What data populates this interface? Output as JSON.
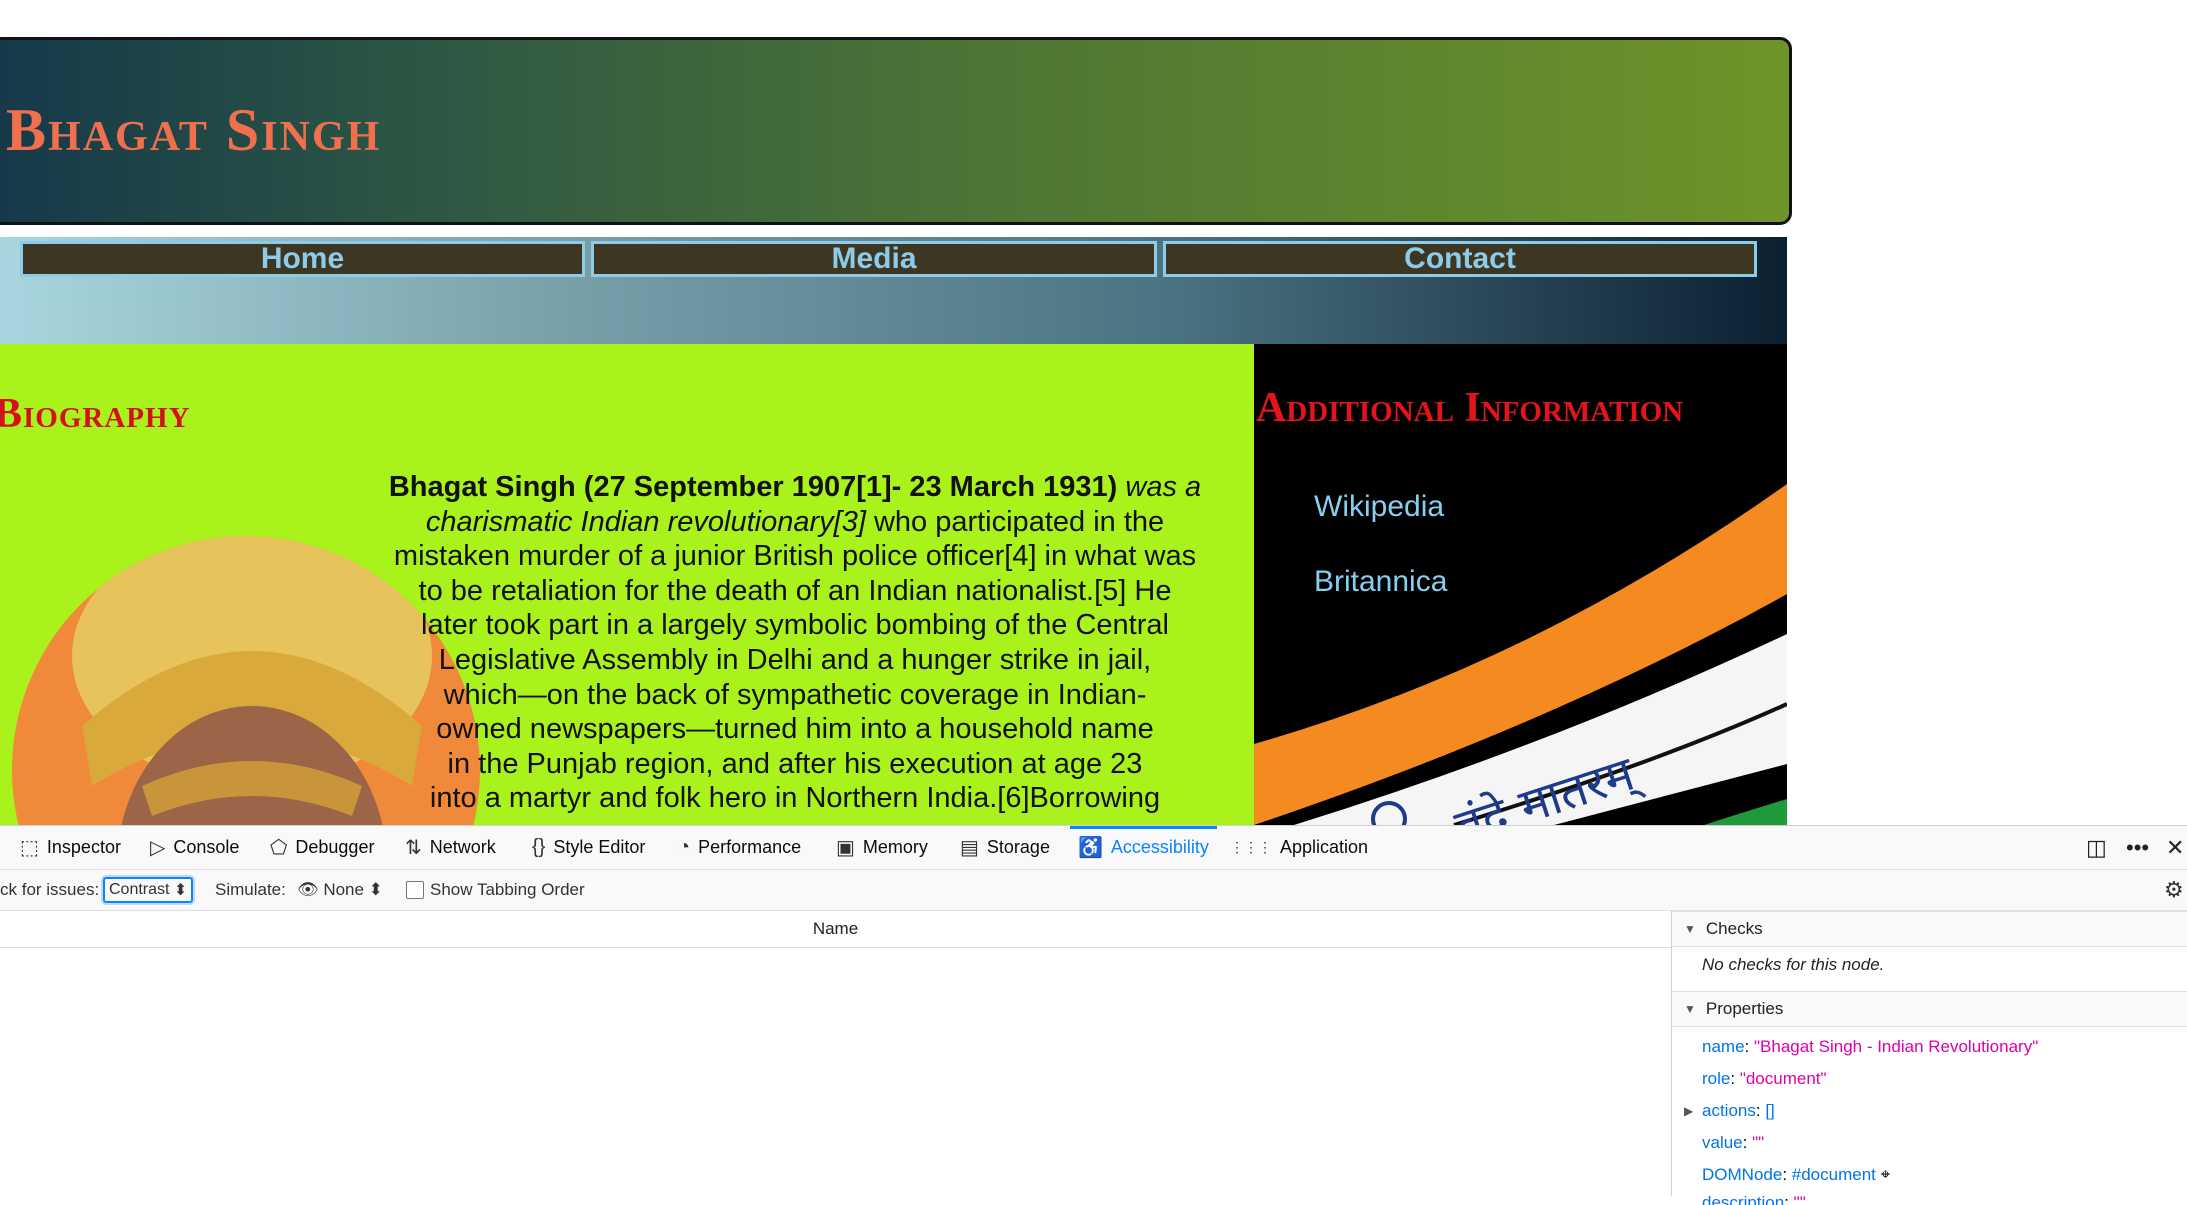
{
  "page": {
    "site_title": "Bhagat Singh",
    "nav": [
      "Home",
      "Media",
      "Contact"
    ],
    "biography_title": "Biography",
    "bio_lines": [
      {
        "parts": [
          {
            "t": "Bhagat Singh (27 September 1907[1]- 23 March 1931)",
            "s": "b"
          },
          {
            "t": " was a",
            "s": "i"
          }
        ]
      },
      {
        "parts": [
          {
            "t": "charismatic Indian revolutionary[3]",
            "s": "i"
          },
          {
            "t": " who participated in the",
            "s": "n"
          }
        ]
      },
      {
        "parts": [
          {
            "t": "mistaken murder of a junior British police officer[4] in what was",
            "s": "n"
          }
        ]
      },
      {
        "parts": [
          {
            "t": "to be retaliation for the death of an Indian nationalist.[5] He",
            "s": "n"
          }
        ]
      },
      {
        "parts": [
          {
            "t": "later took part in a largely symbolic bombing of the Central",
            "s": "n"
          }
        ]
      },
      {
        "parts": [
          {
            "t": "Legislative Assembly in Delhi and a hunger strike in jail,",
            "s": "n"
          }
        ]
      },
      {
        "parts": [
          {
            "t": "which—on the back of sympathetic coverage in Indian-",
            "s": "n"
          }
        ]
      },
      {
        "parts": [
          {
            "t": "owned newspapers—turned him into a household name",
            "s": "n"
          }
        ]
      },
      {
        "parts": [
          {
            "t": "in the Punjab region, and after his execution at age 23",
            "s": "n"
          }
        ]
      },
      {
        "parts": [
          {
            "t": "into a martyr and folk hero in Northern India.[6]Borrowing",
            "s": "n"
          }
        ]
      }
    ],
    "additional_title": "Additional Information",
    "links": [
      "Wikipedia",
      "Britannica"
    ],
    "flag_text": "वंदे मातरम्"
  },
  "devtools": {
    "tabs": [
      {
        "label": "Inspector",
        "icon": "inspector-icon",
        "glyph": "⬚"
      },
      {
        "label": "Console",
        "icon": "console-icon",
        "glyph": "▷"
      },
      {
        "label": "Debugger",
        "icon": "debugger-icon",
        "glyph": "⬠"
      },
      {
        "label": "Network",
        "icon": "network-icon",
        "glyph": "⇅"
      },
      {
        "label": "Style Editor",
        "icon": "style-editor-icon",
        "glyph": "{}"
      },
      {
        "label": "Performance",
        "icon": "performance-icon",
        "glyph": "◔"
      },
      {
        "label": "Memory",
        "icon": "memory-icon",
        "glyph": "▣"
      },
      {
        "label": "Storage",
        "icon": "storage-icon",
        "glyph": "▤"
      },
      {
        "label": "Accessibility",
        "icon": "accessibility-icon",
        "glyph": "♿"
      },
      {
        "label": "Application",
        "icon": "application-icon",
        "glyph": "⋮⋮⋮"
      }
    ],
    "active_tab": "Accessibility",
    "check_label": "ck for issues:",
    "check_value": "Contrast",
    "simulate_label": "Simulate:",
    "simulate_value": "None",
    "tabbing_label": "Show Tabbing Order",
    "tree_column": "Name",
    "checks_title": "Checks",
    "checks_empty": "No checks for this node.",
    "properties_title": "Properties",
    "properties": {
      "name_key": "name",
      "name_val": "\"Bhagat Singh - Indian Revolutionary\"",
      "role_key": "role",
      "role_val": "\"document\"",
      "actions_key": "actions",
      "actions_val": "[]",
      "value_key": "value",
      "value_val": "\"\"",
      "domnode_key": "DOMNode",
      "domnode_val": "#document",
      "description_key": "description",
      "description_val": "\"\""
    }
  },
  "colors": {
    "title": "#f0704e",
    "section_title": "#d4111a",
    "nav_text": "#8ecbe9",
    "bio_bg": "#a9f21b",
    "accent": "#0a84ff"
  }
}
